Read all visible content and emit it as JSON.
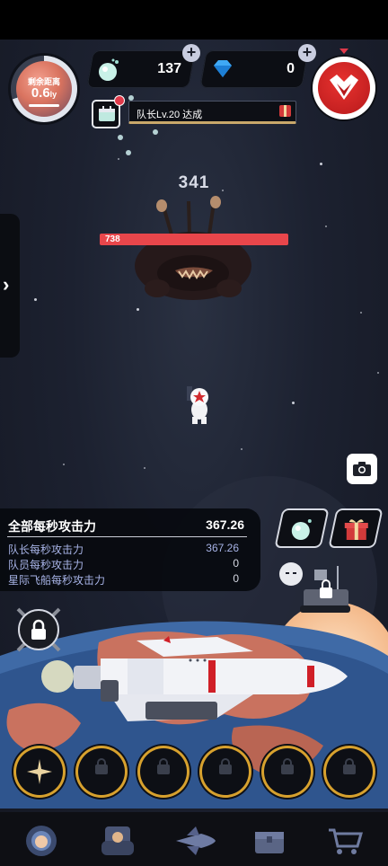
{
  "hud": {
    "distance_label": "剩余距离",
    "distance_value": "0.6",
    "distance_unit": "ly",
    "bombs_count": "137",
    "gems_count": "0"
  },
  "mission": {
    "text": "队长Lv.20 达成"
  },
  "boss": {
    "damage_number": "341",
    "hp_value": "738"
  },
  "stats": {
    "title": "全部每秒攻击力",
    "total": "367.26",
    "rows": [
      {
        "label": "队长每秒攻击力",
        "value": "367.26"
      },
      {
        "label": "队员每秒攻击力",
        "value": "0"
      },
      {
        "label": "星际飞船每秒攻击力",
        "value": "0"
      }
    ]
  },
  "skills": {
    "slots": [
      {
        "state": "unlocked",
        "icon": "sparkle-icon"
      },
      {
        "state": "locked",
        "icon": "lock-icon"
      },
      {
        "state": "locked",
        "icon": "lock-icon"
      },
      {
        "state": "locked",
        "icon": "lock-icon"
      },
      {
        "state": "locked",
        "icon": "lock-icon"
      },
      {
        "state": "locked",
        "icon": "lock-icon"
      }
    ]
  },
  "nav": {
    "items": [
      "astronaut-icon",
      "crew-icon",
      "spaceship-icon",
      "chest-icon",
      "cart-icon"
    ]
  },
  "colors": {
    "hp_bar": "#e8464b",
    "accent_red": "#c3191c",
    "skill_ring": "#d7a12e",
    "stats_text": "#a7b3e6"
  }
}
